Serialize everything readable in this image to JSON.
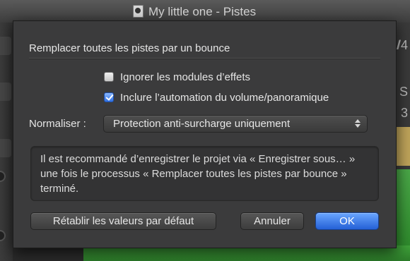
{
  "window": {
    "title": "My little one - Pistes"
  },
  "background": {
    "right_texts": [
      "/",
      "/4",
      "S",
      "3"
    ]
  },
  "dialog": {
    "title": "Remplacer toutes les pistes par un bounce",
    "options": [
      {
        "label": "Ignorer les modules d’effets",
        "checked": false
      },
      {
        "label": "Inclure l’automation du volume/panoramique",
        "checked": true
      }
    ],
    "normalize": {
      "label": "Normaliser :",
      "value": "Protection anti-surcharge uniquement"
    },
    "info": "Il est recommandé d’enregistrer le projet via « Enregistrer sous… » une fois le processus « Remplacer toutes les pistes par bounce » terminé.",
    "buttons": {
      "reset": "Rétablir les valeurs par défaut",
      "cancel": "Annuler",
      "ok": "OK"
    }
  },
  "colors": {
    "accent": "#2f6fe0",
    "waveform": "#3fa33a"
  }
}
